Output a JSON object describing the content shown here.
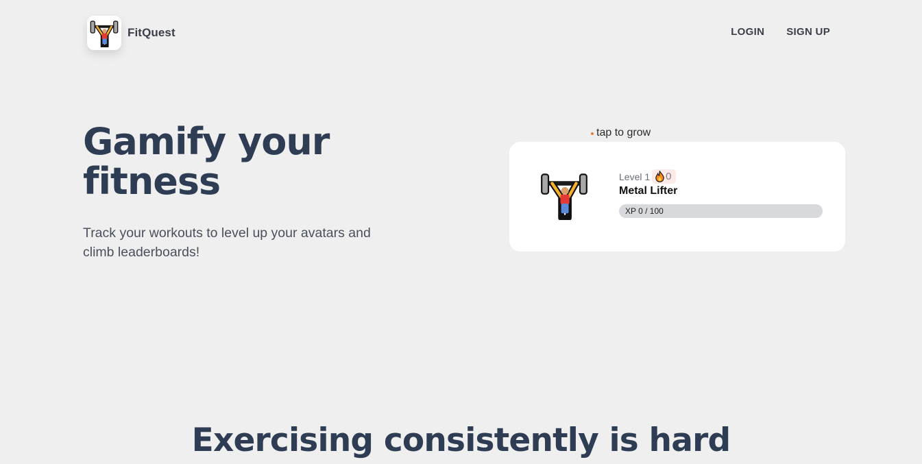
{
  "header": {
    "brand_name": "FitQuest",
    "logo_icon": "weightlifter-icon",
    "nav": {
      "login_label": "LOGIN",
      "signup_label": "SIGN UP"
    }
  },
  "hero": {
    "title": "Gamify your fitness",
    "subtitle": "Track your workouts to level up your avatars and climb leaderboards!"
  },
  "avatar_card": {
    "hint": "tap to grow",
    "avatar_icon": "weightlifter-icon",
    "level_label": "Level 1",
    "streak_icon": "fire-icon",
    "streak_count": "0",
    "name": "Metal Lifter",
    "xp_text": "XP 0 / 100",
    "xp_progress": 0
  },
  "section": {
    "title": "Exercising consistently is hard"
  },
  "colors": {
    "background": "#efefef",
    "heading": "#2f3d54",
    "accent": "#f07a3a",
    "card": "#ffffff",
    "xp_track": "#d8d9dc"
  }
}
